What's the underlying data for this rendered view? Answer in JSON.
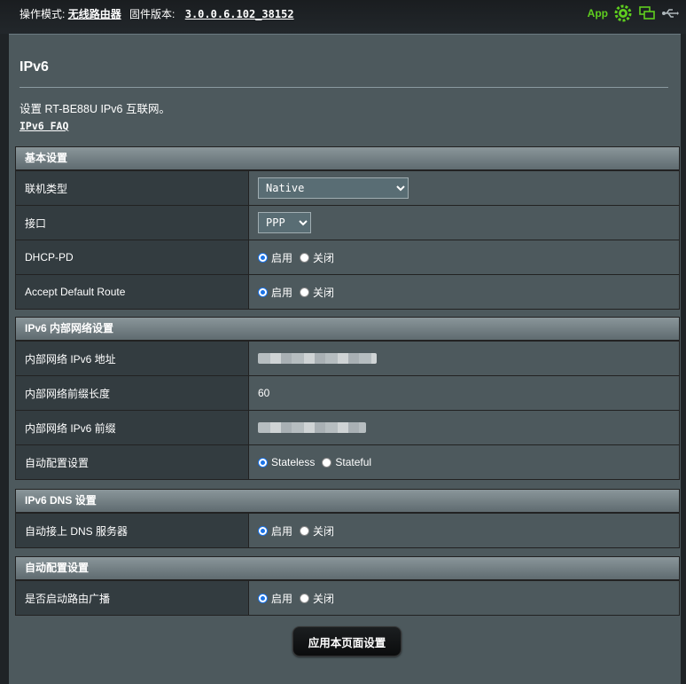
{
  "topbar": {
    "mode_label": "操作模式:",
    "mode_value": "无线路由器",
    "firmware_label": "固件版本:",
    "firmware_value": "3.0.0.6.102_38152",
    "app_label": "App"
  },
  "page": {
    "title": "IPv6",
    "description": "设置 RT-BE88U IPv6 互联网。",
    "faq_link": "IPv6 FAQ"
  },
  "basic": {
    "header": "基本设置",
    "connection_type_label": "联机类型",
    "connection_type_value": "Native",
    "interface_label": "接口",
    "interface_value": "PPP",
    "dhcp_pd_label": "DHCP-PD",
    "accept_route_label": "Accept Default Route",
    "enable": "启用",
    "disable": "关闭"
  },
  "lan": {
    "header": "IPv6 内部网络设置",
    "address_label": "内部网络 IPv6 地址",
    "prefix_length_label": "内部网络前缀长度",
    "prefix_length_value": "60",
    "prefix_label": "内部网络 IPv6 前缀",
    "autoconf_label": "自动配置设置",
    "stateless": "Stateless",
    "stateful": "Stateful"
  },
  "dns": {
    "header": "IPv6 DNS 设置",
    "auto_dns_label": "自动接上 DNS 服务器",
    "enable": "启用",
    "disable": "关闭"
  },
  "autoconf": {
    "header": "自动配置设置",
    "router_adv_label": "是否启动路由广播",
    "enable": "启用",
    "disable": "关闭"
  },
  "apply_button": "应用本页面设置",
  "colors": {
    "panel": "#4d595d",
    "label_bg": "#333c40",
    "app_green": "#5fce1f",
    "radio_blue": "#1a73e8"
  },
  "icons": [
    "gear-icon",
    "monitor-icon",
    "usb-icon"
  ]
}
